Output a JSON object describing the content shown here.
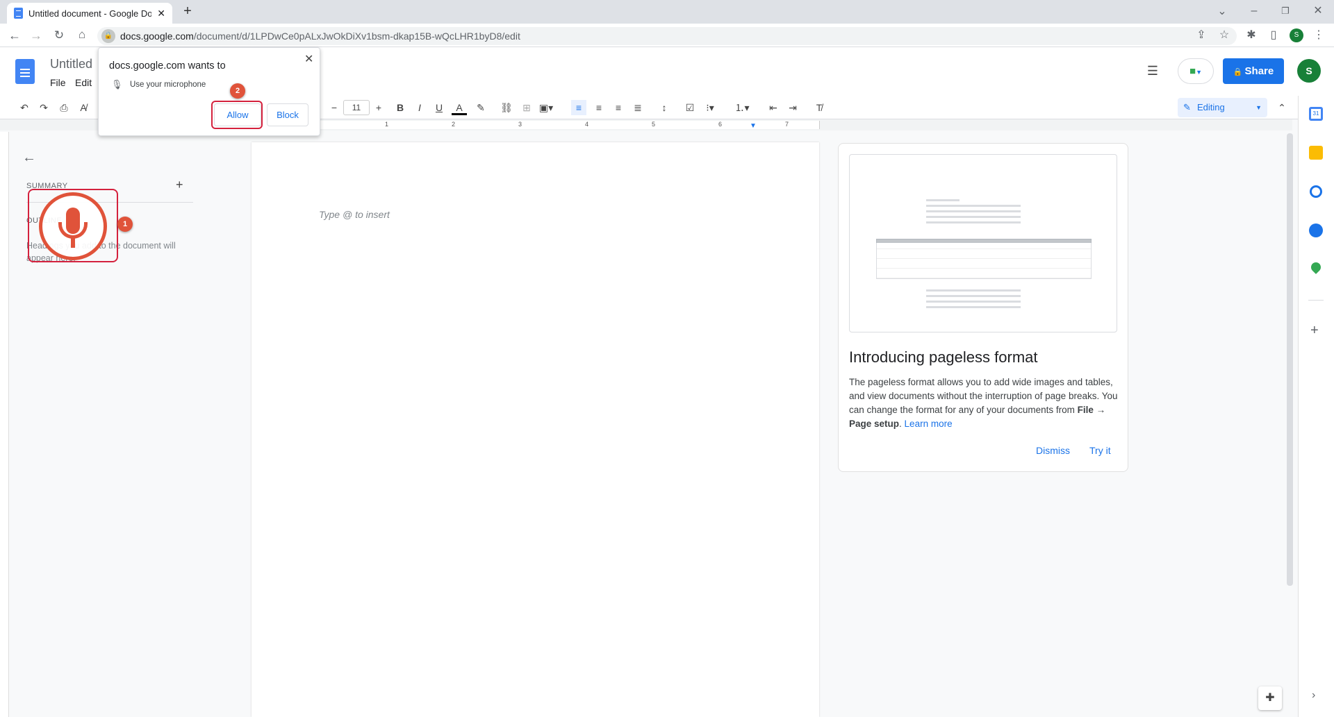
{
  "browser": {
    "tab_title": "Untitled document - Google Doc",
    "url_host": "docs.google.com",
    "url_path": "/document/d/1LPDwCe0pALxJwOkDiXv1bsm-dkap15B-wQcLHR1byD8/edit",
    "profile_initial": "S"
  },
  "docs": {
    "title": "Untitled",
    "menu": [
      "File",
      "Edit"
    ],
    "share_label": "Share",
    "avatar_initial": "S",
    "font_size": "11",
    "mode_label": "Editing",
    "ruler_numbers": [
      "1",
      "2",
      "3",
      "4",
      "5",
      "6",
      "7"
    ]
  },
  "popup": {
    "title": "docs.google.com wants to",
    "permission": "Use your microphone",
    "allow_label": "Allow",
    "block_label": "Block"
  },
  "annotations": {
    "step1": "1",
    "step2": "2"
  },
  "sidebar": {
    "summary_label": "SUMMARY",
    "outline_label": "OUTLINE",
    "outline_hint": "Headings you add to the document will appear here."
  },
  "page": {
    "placeholder": "Type @ to insert"
  },
  "card": {
    "title": "Introducing pageless format",
    "body_1": "The pageless format allows you to add wide images and tables, and view documents without the interruption of page breaks. You can change the format for any of your documents from ",
    "body_bold": "File → Page setup",
    "body_2": ". ",
    "learn_more": "Learn more",
    "dismiss": "Dismiss",
    "try_it": "Try it"
  },
  "colors": {
    "accent": "#1a73e8",
    "annotation": "#e0533a",
    "avatar": "#188038"
  }
}
